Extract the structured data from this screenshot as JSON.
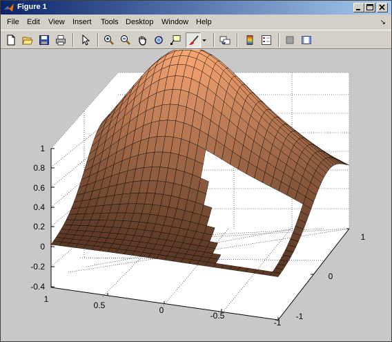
{
  "window": {
    "title": "Figure 1"
  },
  "menu": {
    "items": [
      "File",
      "Edit",
      "View",
      "Insert",
      "Tools",
      "Desktop",
      "Window",
      "Help"
    ],
    "dock_arrow": "↘"
  },
  "toolbar": {
    "buttons": [
      {
        "name": "new-figure-icon"
      },
      {
        "name": "open-file-icon"
      },
      {
        "name": "save-figure-icon"
      },
      {
        "name": "print-figure-icon"
      },
      {
        "name": "edit-plot-arrow-icon"
      },
      {
        "name": "zoom-in-icon"
      },
      {
        "name": "zoom-out-icon"
      },
      {
        "name": "pan-hand-icon"
      },
      {
        "name": "rotate-3d-icon"
      },
      {
        "name": "data-cursor-icon"
      },
      {
        "name": "brush-icon",
        "active": true
      },
      {
        "name": "link-plot-icon"
      },
      {
        "name": "insert-colorbar-icon"
      },
      {
        "name": "insert-legend-icon"
      },
      {
        "name": "hide-plot-tools-icon"
      },
      {
        "name": "show-plot-tools-icon"
      }
    ]
  },
  "axes": {
    "z_ticks": [
      "1",
      "0.8",
      "0.6",
      "0.4",
      "0.2",
      "0",
      "-0.2",
      "-0.4"
    ],
    "x_ticks": [
      "1",
      "0.5",
      "0",
      "-0.5",
      "-1"
    ],
    "y_ticks": [
      "1",
      "0",
      "-1"
    ],
    "surface_colormap": "copper",
    "grid": true
  },
  "colors": {
    "surface_light": "#f7a472",
    "surface_dark": "#3a2216",
    "figure_bg": "#c8c8c8",
    "title_bar_start": "#0a246a",
    "title_bar_end": "#a6caf0"
  }
}
